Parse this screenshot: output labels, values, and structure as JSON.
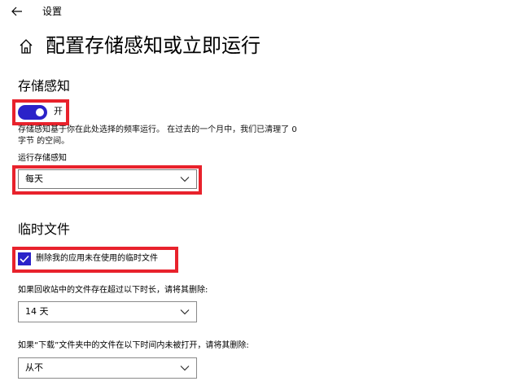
{
  "window": {
    "title": "设置",
    "back_icon": "arrow-left-icon"
  },
  "page": {
    "title": "配置存储感知或立即运行",
    "home_icon": "home-icon"
  },
  "storage_sense": {
    "section_title": "存储感知",
    "toggle_state": "开",
    "toggle_on": true,
    "description": "存储感知基于你在此处选择的频率运行。 在过去的一个月中，我们已清理了 0 字节 的空间。",
    "run_label": "运行存储感知",
    "run_value": "每天"
  },
  "temp_files": {
    "section_title": "临时文件",
    "delete_unused_label": "删除我的应用未在使用的临时文件",
    "delete_unused_checked": true,
    "recycle_bin_label": "如果回收站中的文件存在超过以下时长，请将其删除:",
    "recycle_bin_value": "14 天",
    "downloads_label": "如果“下载”文件夹中的文件在以下时间内未被打开，请将其删除:",
    "downloads_value": "从不"
  },
  "colors": {
    "accent": "#2b22c9",
    "highlight": "#e8222c"
  }
}
